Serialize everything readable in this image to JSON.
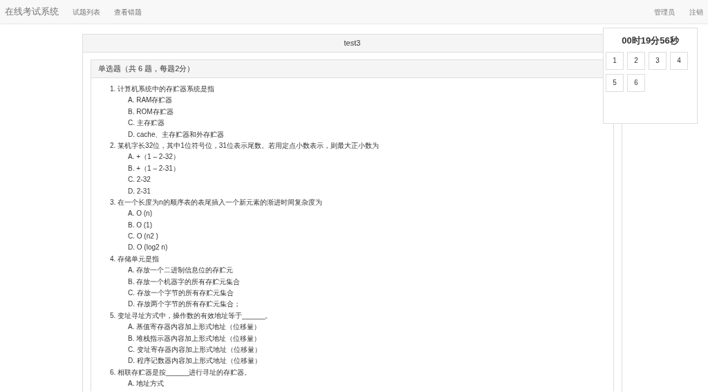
{
  "navbar": {
    "brand": "在线考试系统",
    "left_links": [
      "试题列表",
      "查看错题"
    ],
    "right_links": [
      "管理员",
      "注销"
    ]
  },
  "exam": {
    "title": "test3",
    "section_title": "单选题（共 6 题，每题2分）",
    "questions": [
      {
        "number": "1.",
        "text": "计算机系统中的存贮器系统是指",
        "options": [
          "A. RAM存贮器",
          "B. ROM存贮器",
          "C. 主存贮器",
          "D. cache、主存贮器和外存贮器"
        ]
      },
      {
        "number": "2.",
        "text": "某机字长32位，其中1位符号位，31位表示尾数。若用定点小数表示，则最大正小数为",
        "options": [
          "A. +（1 – 2-32）",
          "B. +（1 – 2-31）",
          "C. 2-32",
          "D. 2-31"
        ]
      },
      {
        "number": "3.",
        "text": "在一个长度为n的顺序表的表尾插入一个新元素的渐进时间复杂度为",
        "options": [
          "A. O (n)",
          "B. O (1)",
          "C. O (n2 )",
          "D. O (log2 n)"
        ]
      },
      {
        "number": "4.",
        "text": "存储单元是指",
        "options": [
          "A. 存放一个二进制信息位的存贮元",
          "B. 存放一个机器字的所有存贮元集合",
          "C. 存放一个字节的所有存贮元集合",
          "D. 存放两个字节的所有存贮元集合；"
        ]
      },
      {
        "number": "5.",
        "text": "变址寻址方式中，操作数的有效地址等于______。",
        "options": [
          "A. 基值寄存器内容加上形式地址（位移量）",
          "B. 堆栈指示器内容加上形式地址（位移量）",
          "C. 变址寄存器内容加上形式地址（位移量）",
          "D. 程序记数器内容加上形式地址（位移量）"
        ]
      },
      {
        "number": "6.",
        "text": "相联存贮器是按______进行寻址的存贮器。",
        "options": [
          "A. 地址方式"
        ]
      }
    ]
  },
  "timer": {
    "time": "00时19分56秒",
    "question_buttons": [
      "1",
      "2",
      "3",
      "4",
      "5",
      "6"
    ]
  }
}
